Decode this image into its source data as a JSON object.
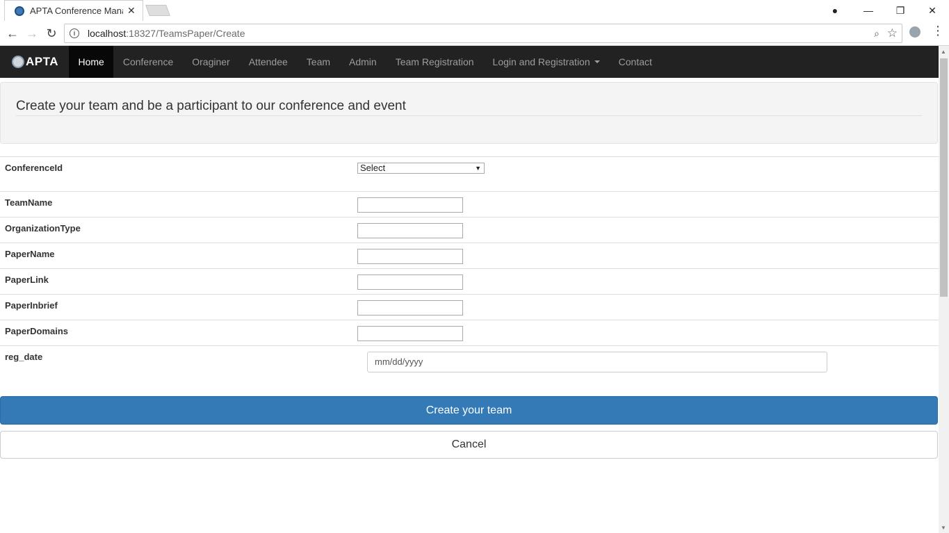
{
  "browser": {
    "tab_title": "APTA Conference Manag",
    "url_host": "localhost",
    "url_path": ":18327/TeamsPaper/Create",
    "tab_close": "✕",
    "min": "—",
    "restore": "❐",
    "close": "✕",
    "back": "←",
    "forward": "→",
    "reload": "↻",
    "info": "i",
    "zoom": "⌕",
    "star": "☆",
    "menu": "⋮",
    "account": "●"
  },
  "navbar": {
    "brand": "APTA",
    "items": [
      {
        "label": "Home",
        "active": true
      },
      {
        "label": "Conference"
      },
      {
        "label": "Oraginer"
      },
      {
        "label": "Attendee"
      },
      {
        "label": "Team"
      },
      {
        "label": "Admin"
      },
      {
        "label": "Team Registration"
      },
      {
        "label": "Login and Registration",
        "dropdown": true
      },
      {
        "label": "Contact"
      }
    ]
  },
  "jumbotron": {
    "heading": "Create your team and be a participant to our conference and event"
  },
  "form": {
    "conference_label": "ConferenceId",
    "conference_selected": "Select",
    "team_name_label": "TeamName",
    "team_name_value": "",
    "org_type_label": "OrganizationType",
    "org_type_value": "",
    "paper_name_label": "PaperName",
    "paper_name_value": "",
    "paper_link_label": "PaperLink",
    "paper_link_value": "",
    "paper_inbrief_label": "PaperInbrief",
    "paper_inbrief_value": "",
    "paper_domains_label": "PaperDomains",
    "paper_domains_value": "",
    "reg_date_label": "reg_date",
    "reg_date_placeholder": "mm/dd/yyyy",
    "submit_label": "Create your team",
    "cancel_label": "Cancel"
  },
  "colors": {
    "navbar_bg": "#222222",
    "primary": "#337ab7"
  }
}
